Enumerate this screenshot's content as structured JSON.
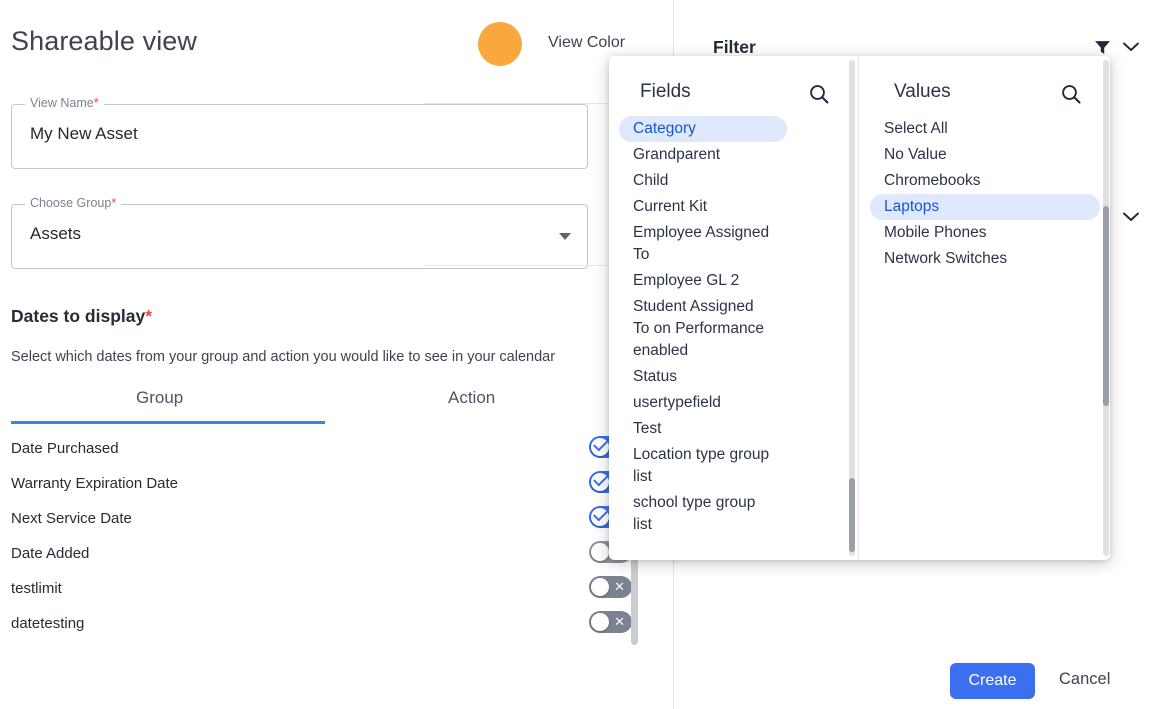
{
  "form": {
    "title": "Shareable view",
    "view_color_label": "View Color",
    "view_color_hex": "#F9A83E",
    "view_name": {
      "legend": "View Name",
      "required": "*",
      "value": "My New Asset"
    },
    "choose_group": {
      "legend": "Choose Group",
      "required": "*",
      "value": "Assets",
      "caret_icon": "chevron-down-icon"
    },
    "dates_heading": "Dates to display",
    "dates_heading_required": "*",
    "dates_subtitle": "Select which dates from your group and action you would like to see in your calendar",
    "tabs": [
      {
        "label": "Group",
        "active": true
      },
      {
        "label": "Action",
        "active": false
      }
    ],
    "date_rows": [
      {
        "label": "Date Purchased",
        "state": "on"
      },
      {
        "label": "Warranty Expiration Date",
        "state": "on"
      },
      {
        "label": "Next Service Date",
        "state": "on"
      },
      {
        "label": "Date Added",
        "state": "plain"
      },
      {
        "label": "testlimit",
        "state": "off"
      },
      {
        "label": "datetesting",
        "state": "off"
      }
    ]
  },
  "right": {
    "filter_title": "Filter",
    "filter_icon": "funnel-icon",
    "filter_chevron_icon": "chevron-down-icon",
    "section_chevron_icon": "chevron-down-icon"
  },
  "popup": {
    "fields": {
      "heading": "Fields",
      "search_icon": "search-icon",
      "options": [
        {
          "label": "Category",
          "selected": true
        },
        {
          "label": "Grandparent",
          "selected": false
        },
        {
          "label": "Child",
          "selected": false
        },
        {
          "label": "Current Kit",
          "selected": false
        },
        {
          "label": "Employee Assigned To",
          "selected": false
        },
        {
          "label": "Employee GL 2",
          "selected": false
        },
        {
          "label": "Student Assigned To on Performance enabled",
          "selected": false
        },
        {
          "label": "Status",
          "selected": false
        },
        {
          "label": "usertypefield",
          "selected": false
        },
        {
          "label": "Test",
          "selected": false
        },
        {
          "label": "Location type group list",
          "selected": false
        },
        {
          "label": "school type group list",
          "selected": false
        }
      ]
    },
    "values": {
      "heading": "Values",
      "search_icon": "search-icon",
      "options": [
        {
          "label": "Select All",
          "selected": false
        },
        {
          "label": "No Value",
          "selected": false
        },
        {
          "label": "Chromebooks",
          "selected": false
        },
        {
          "label": "Laptops",
          "selected": true
        },
        {
          "label": "Mobile Phones",
          "selected": false
        },
        {
          "label": "Network Switches",
          "selected": false
        }
      ]
    }
  },
  "footer": {
    "create_label": "Create",
    "cancel_label": "Cancel"
  }
}
